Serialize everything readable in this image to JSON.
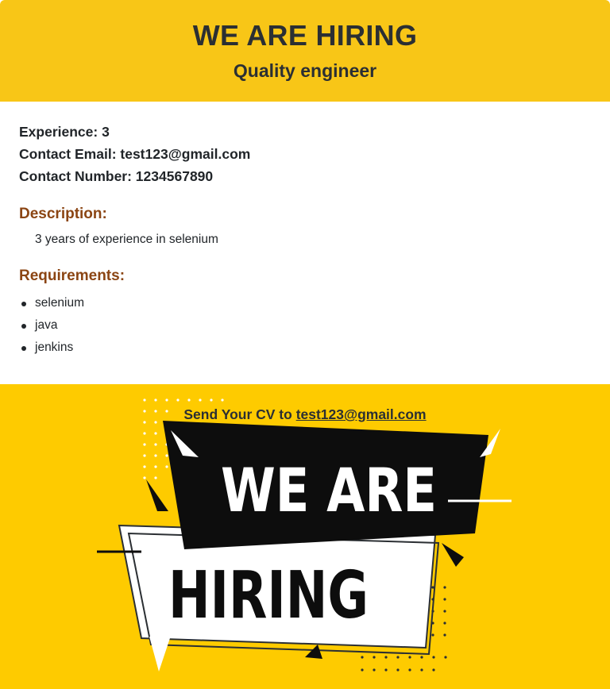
{
  "header": {
    "title": "WE ARE HIRING",
    "subtitle": "Quality engineer"
  },
  "details": {
    "experience": "Experience: 3",
    "email": "Contact Email: test123@gmail.com",
    "phone": "Contact Number: 1234567890"
  },
  "description": {
    "title": "Description:",
    "text": "3 years of experience in selenium"
  },
  "requirements": {
    "title": "Requirements:",
    "items": [
      "selenium",
      "java",
      "jenkins"
    ]
  },
  "footer": {
    "cv_prefix": "Send Your CV to",
    "cv_email": "test123@gmail.com",
    "banner_line1": "WE ARE",
    "banner_line2": "HIRING"
  },
  "colors": {
    "header_bg": "#f8c617",
    "footer_bg": "#fecb00",
    "section_title": "#8b4513"
  }
}
